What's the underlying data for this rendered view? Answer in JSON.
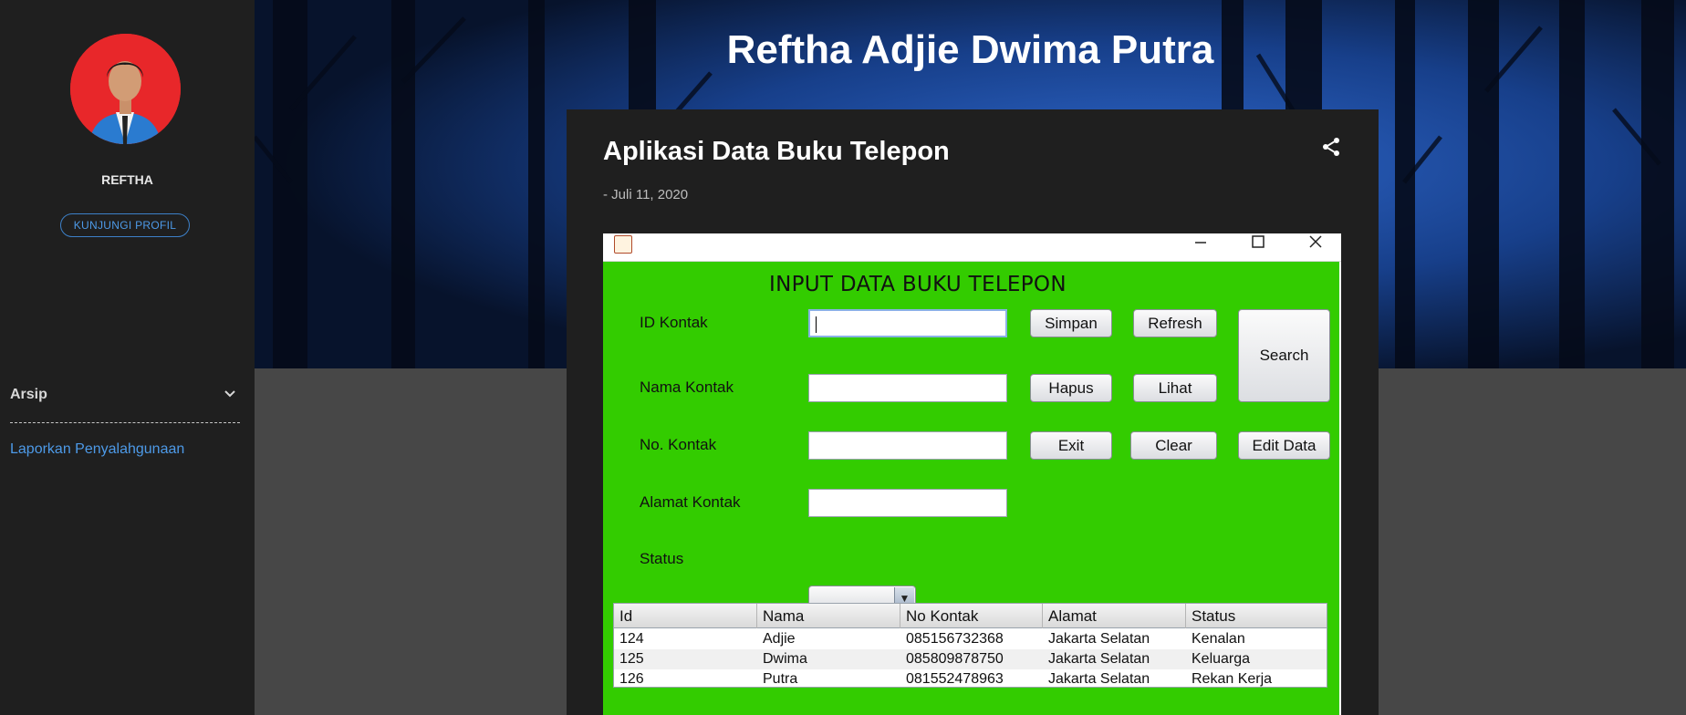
{
  "sidebar": {
    "profile_name": "REFTHA",
    "profile_button": "KUNJUNGI PROFIL",
    "archive_label": "Arsip",
    "report_link": "Laporkan Penyalahgunaan"
  },
  "header": {
    "blog_title": "Reftha Adjie Dwima Putra"
  },
  "post": {
    "title": "Aplikasi Data Buku Telepon",
    "date": "- Juli 11, 2020"
  },
  "app": {
    "form_title": "INPUT DATA BUKU TELEPON",
    "labels": {
      "id": "ID Kontak",
      "nama": "Nama Kontak",
      "no": "No. Kontak",
      "alamat": "Alamat Kontak",
      "status": "Status"
    },
    "buttons": {
      "simpan": "Simpan",
      "refresh": "Refresh",
      "search": "Search",
      "hapus": "Hapus",
      "lihat": "Lihat",
      "exit": "Exit",
      "clear": "Clear",
      "edit": "Edit Data"
    },
    "combo_arrow": "▼",
    "table": {
      "headers": [
        "Id",
        "Nama",
        "No Kontak",
        "Alamat",
        "Status"
      ],
      "rows": [
        [
          "124",
          "Adjie",
          "085156732368",
          "Jakarta Selatan",
          "Kenalan"
        ],
        [
          "125",
          "Dwima",
          "085809878750",
          "Jakarta Selatan",
          "Keluarga"
        ],
        [
          "126",
          "Putra",
          "081552478963",
          "Jakarta Selatan",
          "Rekan Kerja"
        ]
      ]
    }
  },
  "colors": {
    "accent_link": "#4d9ae8",
    "form_green": "#33cc00",
    "avatar_bg": "#e8272a"
  }
}
